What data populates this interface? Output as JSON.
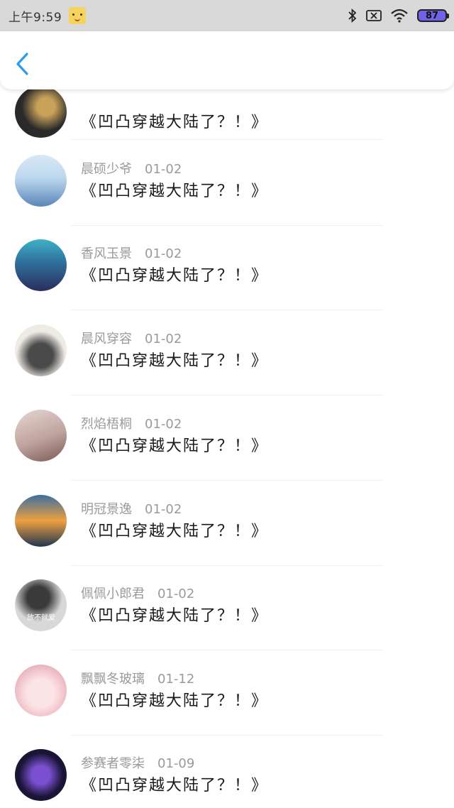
{
  "status_bar": {
    "time": "上午9:59",
    "battery": "87"
  },
  "comments": [
    {
      "username": "",
      "date": "",
      "message": "《凹凸穿越大陆了？！》",
      "avatar_colors": [
        "#2a2a2a",
        "#c9a25a"
      ]
    },
    {
      "username": "晨硕少爷",
      "date": "01-02",
      "message": "《凹凸穿越大陆了？！》",
      "avatar_colors": [
        "#bcd7ee",
        "#5b86b8"
      ]
    },
    {
      "username": "香风玉景",
      "date": "01-02",
      "message": "《凹凸穿越大陆了？！》",
      "avatar_colors": [
        "#3fb0c8",
        "#2a2e5e"
      ]
    },
    {
      "username": "晨风穿容",
      "date": "01-02",
      "message": "《凹凸穿越大陆了？！》",
      "avatar_colors": [
        "#eeeae4",
        "#4a4a4a"
      ]
    },
    {
      "username": "烈焰梧桐",
      "date": "01-02",
      "message": "《凹凸穿越大陆了？！》",
      "avatar_colors": [
        "#e6d6d2",
        "#7a5a55"
      ]
    },
    {
      "username": "明冠景逸",
      "date": "01-02",
      "message": "《凹凸穿越大陆了？！》",
      "avatar_colors": [
        "#f0a040",
        "#1f3550"
      ]
    },
    {
      "username": "佩佩小郎君",
      "date": "01-02",
      "message": "《凹凸穿越大陆了？！》",
      "avatar_colors": [
        "#d8d8d8",
        "#3a3a3a"
      ],
      "avatar_caption": "放不就爱"
    },
    {
      "username": "飘飘冬玻璃",
      "date": "01-12",
      "message": "《凹凸穿越大陆了？！》",
      "avatar_colors": [
        "#f6d2d6",
        "#d88fa0"
      ]
    },
    {
      "username": "参赛者零柒",
      "date": "01-09",
      "message": "《凹凸穿越大陆了？！》",
      "avatar_colors": [
        "#1a1436",
        "#7a4fd0"
      ]
    }
  ]
}
